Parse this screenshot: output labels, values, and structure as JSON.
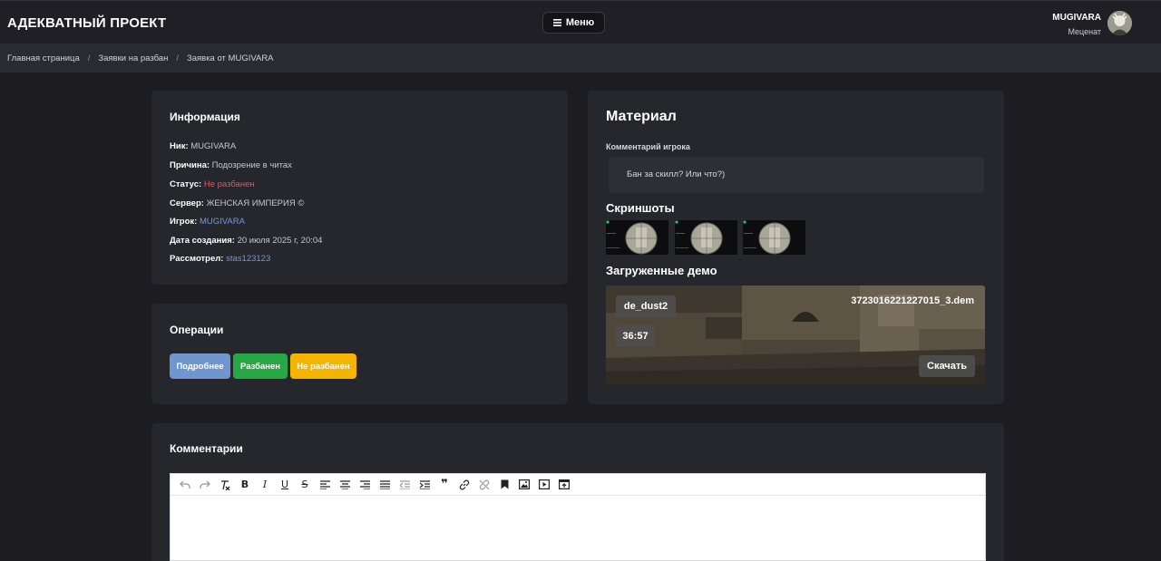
{
  "header": {
    "brand": "АДЕКВАТНЫЙ ПРОЕКТ",
    "menu_label": "Меню",
    "user_name": "MUGIVARA",
    "user_role": "Меценат"
  },
  "breadcrumbs": [
    "Главная страница",
    "Заявки на разбан",
    "Заявка от MUGIVARA"
  ],
  "info": {
    "title": "Информация",
    "rows": [
      {
        "label": "Ник:",
        "value": "MUGIVARA"
      },
      {
        "label": "Причина:",
        "value": "Подозрение в читах"
      },
      {
        "label": "Статус:",
        "value": "Не разбанен"
      },
      {
        "label": "Сервер:",
        "value": "ЖЕНСКАЯ ИМПЕРИЯ ©"
      },
      {
        "label": "Игрок:",
        "value": "MUGIVARA"
      },
      {
        "label": "Дата создания:",
        "value": "20 июля 2025 г, 20:04"
      },
      {
        "label": "Рассмотрел:",
        "value": "stas123123"
      }
    ]
  },
  "operations": {
    "title": "Операции",
    "details_label": "Подробнее",
    "unban_label": "Разбанен",
    "not_unban_label": "Не разбанен"
  },
  "material": {
    "title": "Материал",
    "comment_label": "Комментарий игрока",
    "comment_text": "Бан за скилл? Или что?)",
    "screenshots_title": "Скриншоты",
    "demos_title": "Загруженные демо",
    "demo": {
      "map": "de_dust2",
      "duration": "36:57",
      "filename": "3723016221227015_3.dem",
      "download_label": "Скачать"
    }
  },
  "comments": {
    "title": "Комментарии"
  },
  "colors": {
    "details": "#6f96cf",
    "unban": "#28a745",
    "not_unban": "#f4b400",
    "status_red": "#e05a5a",
    "link_blue": "#6f9bd6"
  }
}
